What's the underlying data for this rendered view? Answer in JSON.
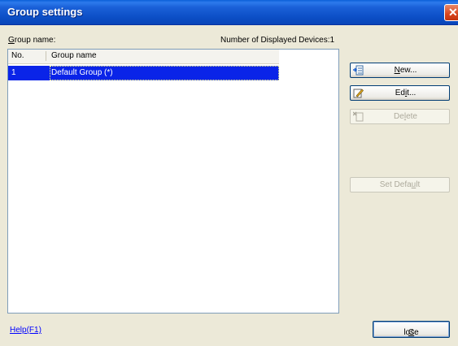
{
  "window": {
    "title": "Group settings"
  },
  "labels": {
    "group_name_prefix": "G",
    "group_name_rest": "roup name:",
    "displayed_devices": "Number of Displayed Devices:1"
  },
  "table": {
    "columns": [
      "No.",
      "Group name"
    ],
    "rows": [
      {
        "no": "1",
        "name": "Default Group (*)",
        "selected": true
      }
    ]
  },
  "buttons": {
    "new": {
      "mnemonic": "N",
      "rest": "ew...",
      "icon": "new-group-icon"
    },
    "edit": {
      "pre": "Ed",
      "mnemonic": "i",
      "rest": "t...",
      "icon": "edit-pencil-icon"
    },
    "delete": {
      "pre": "De",
      "mnemonic": "l",
      "rest": "ete",
      "icon": "delete-icon"
    },
    "set_default": {
      "pre": "Set Defa",
      "mnemonic": "u",
      "rest": "lt"
    },
    "close": {
      "mnemonic": "C",
      "rest": "lose"
    }
  },
  "help": {
    "label": "Help(F1)"
  },
  "colors": {
    "selection": "#0A24E8",
    "titlebar": "#0A4DC4",
    "link": "#0000FF"
  }
}
